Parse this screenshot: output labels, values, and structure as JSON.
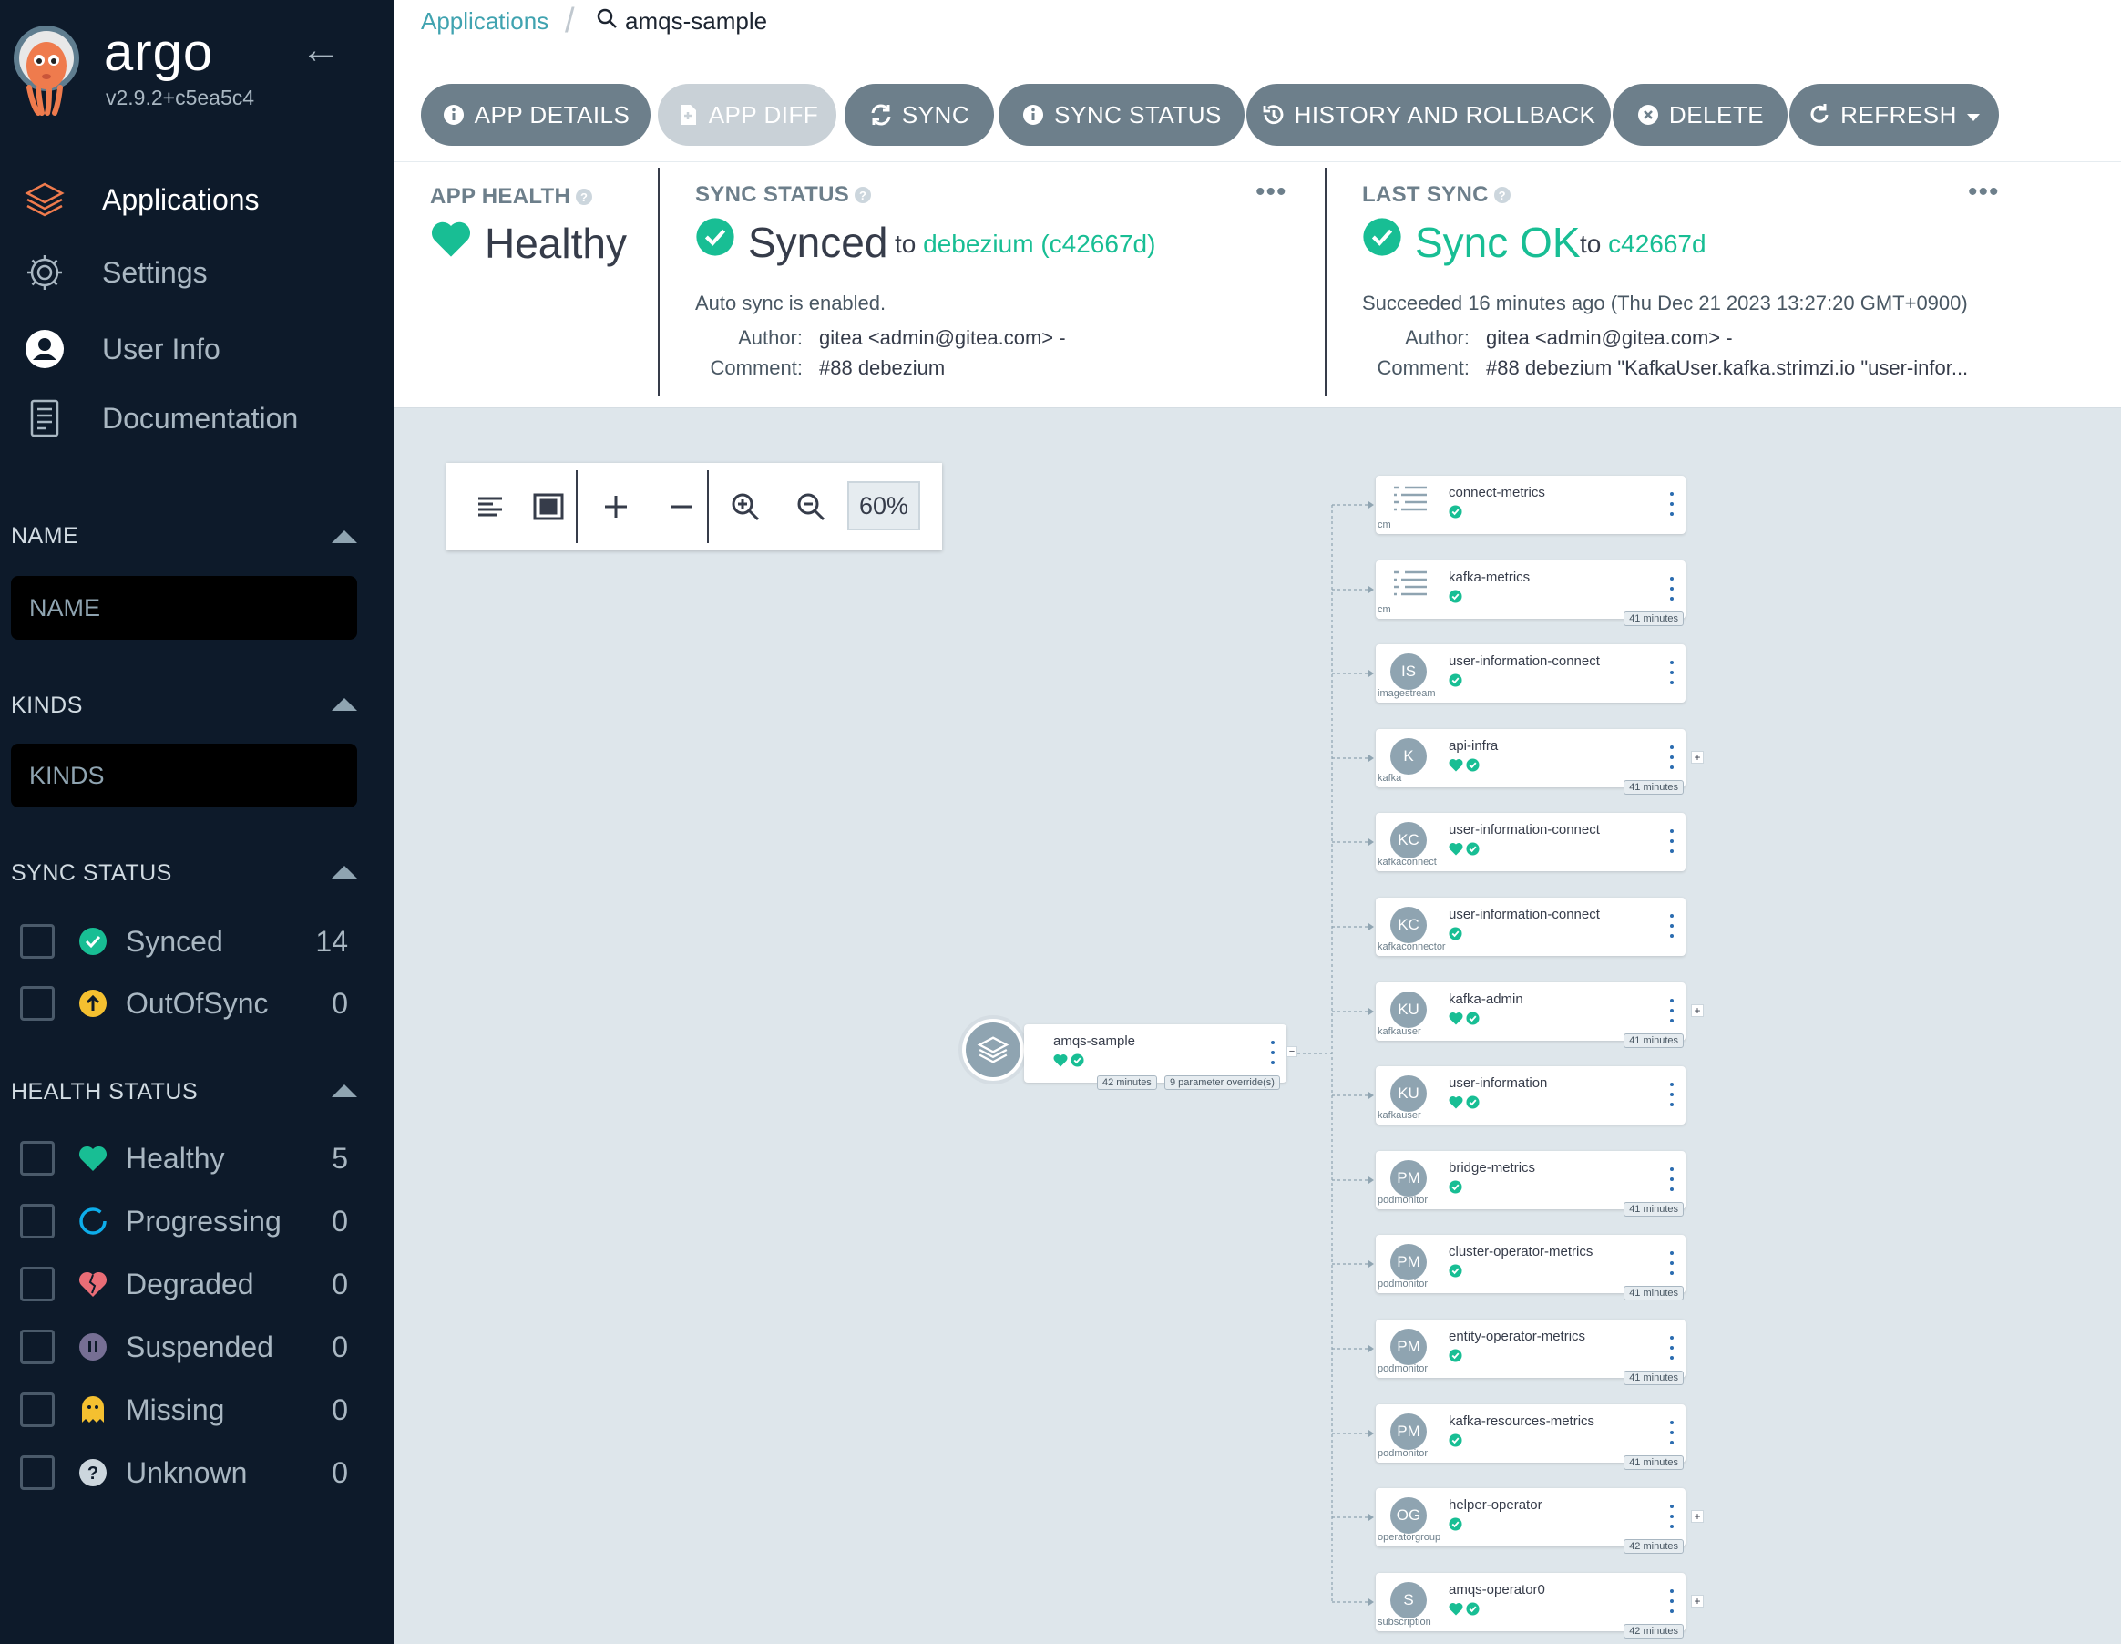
{
  "sidebar": {
    "brand": "argo",
    "version": "v2.9.2+c5ea5c4",
    "nav": [
      {
        "label": "Applications",
        "icon": "layers-icon"
      },
      {
        "label": "Settings",
        "icon": "gear-icon"
      },
      {
        "label": "User Info",
        "icon": "user-icon"
      },
      {
        "label": "Documentation",
        "icon": "book-icon"
      }
    ],
    "name_title": "NAME",
    "name_placeholder": "NAME",
    "kinds_title": "KINDS",
    "kinds_placeholder": "KINDS",
    "sync_title": "SYNC STATUS",
    "sync": [
      {
        "label": "Synced",
        "count": "14",
        "color": "#18be94"
      },
      {
        "label": "OutOfSync",
        "count": "0",
        "color": "#f4c030"
      }
    ],
    "health_title": "HEALTH STATUS",
    "health": [
      {
        "label": "Healthy",
        "count": "5",
        "color": "#18be94"
      },
      {
        "label": "Progressing",
        "count": "0",
        "color": "#0dadea"
      },
      {
        "label": "Degraded",
        "count": "0",
        "color": "#e96d76"
      },
      {
        "label": "Suspended",
        "count": "0",
        "color": "#766f94"
      },
      {
        "label": "Missing",
        "count": "0",
        "color": "#f4c030"
      },
      {
        "label": "Unknown",
        "count": "0",
        "color": "#ccd6dd"
      }
    ]
  },
  "breadcrumb": {
    "root": "Applications",
    "current": "amqs-sample"
  },
  "actions": {
    "app_details": "APP DETAILS",
    "app_diff": "APP DIFF",
    "sync": "SYNC",
    "sync_status": "SYNC STATUS",
    "history": "HISTORY AND ROLLBACK",
    "delete": "DELETE",
    "refresh": "REFRESH"
  },
  "status": {
    "health_title": "APP HEALTH",
    "health_value": "Healthy",
    "sync_title": "SYNC STATUS",
    "sync_value": "Synced",
    "sync_to": "to",
    "sync_target": "debezium (c42667d)",
    "auto_sync": "Auto sync is enabled.",
    "author_label": "Author:",
    "author": "gitea <admin@gitea.com> -",
    "comment_label": "Comment:",
    "comment": "#88 debezium",
    "last_title": "LAST SYNC",
    "last_value": "Sync OK",
    "last_to": "to",
    "last_target": "c42667d",
    "last_succeeded": "Succeeded 16 minutes ago (Thu Dec 21 2023 13:27:20 GMT+0900)",
    "last_author_label": "Author:",
    "last_author": "gitea <admin@gitea.com> -",
    "last_comment_label": "Comment:",
    "last_comment": "#88 debezium \"KafkaUser.kafka.strimzi.io \"user-infor..."
  },
  "graph": {
    "zoom": "60%",
    "root": {
      "name": "amqs-sample",
      "age": "42 minutes",
      "overrides": "9 parameter override(s)"
    },
    "nodes": [
      {
        "icon": "cm",
        "kind": "cm",
        "name": "connect-metrics",
        "health": false,
        "age": "",
        "plus": false
      },
      {
        "icon": "cm",
        "kind": "cm",
        "name": "kafka-metrics",
        "health": false,
        "age": "41 minutes",
        "plus": false
      },
      {
        "icon": "IS",
        "kind": "imagestream",
        "name": "user-information-connect",
        "health": false,
        "age": "",
        "plus": false
      },
      {
        "icon": "K",
        "kind": "kafka",
        "name": "api-infra",
        "health": true,
        "age": "41 minutes",
        "plus": true
      },
      {
        "icon": "KC",
        "kind": "kafkaconnect",
        "name": "user-information-connect",
        "health": true,
        "age": "",
        "plus": false
      },
      {
        "icon": "KC",
        "kind": "kafkaconnector",
        "name": "user-information-connect",
        "health": false,
        "age": "",
        "plus": false
      },
      {
        "icon": "KU",
        "kind": "kafkauser",
        "name": "kafka-admin",
        "health": true,
        "age": "41 minutes",
        "plus": true
      },
      {
        "icon": "KU",
        "kind": "kafkauser",
        "name": "user-information",
        "health": true,
        "age": "",
        "plus": false
      },
      {
        "icon": "PM",
        "kind": "podmonitor",
        "name": "bridge-metrics",
        "health": false,
        "age": "41 minutes",
        "plus": false
      },
      {
        "icon": "PM",
        "kind": "podmonitor",
        "name": "cluster-operator-metrics",
        "health": false,
        "age": "41 minutes",
        "plus": false
      },
      {
        "icon": "PM",
        "kind": "podmonitor",
        "name": "entity-operator-metrics",
        "health": false,
        "age": "41 minutes",
        "plus": false
      },
      {
        "icon": "PM",
        "kind": "podmonitor",
        "name": "kafka-resources-metrics",
        "health": false,
        "age": "41 minutes",
        "plus": false
      },
      {
        "icon": "OG",
        "kind": "operatorgroup",
        "name": "helper-operator",
        "health": false,
        "age": "42 minutes",
        "plus": true
      },
      {
        "icon": "S",
        "kind": "subscription",
        "name": "amqs-operator0",
        "health": true,
        "age": "42 minutes",
        "plus": true
      }
    ]
  }
}
